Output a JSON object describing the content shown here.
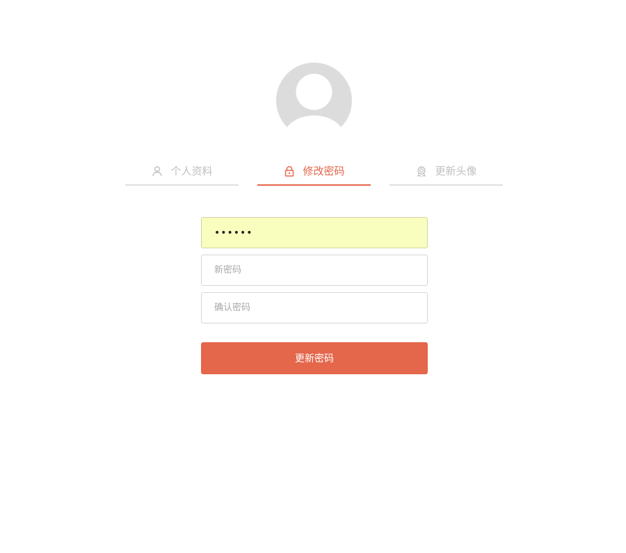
{
  "avatar": {
    "icon": "user-silhouette-icon"
  },
  "tabs": [
    {
      "label": "个人资料",
      "icon": "user-icon",
      "active": false
    },
    {
      "label": "修改密码",
      "icon": "lock-icon",
      "active": true
    },
    {
      "label": "更新头像",
      "icon": "badge-icon",
      "active": false
    }
  ],
  "form": {
    "old_password_value": "••••••",
    "new_password_placeholder": "新密码",
    "confirm_password_placeholder": "确认密码",
    "submit_label": "更新密码"
  },
  "colors": {
    "accent": "#e4664b",
    "inactive_text": "#c0c0c0",
    "autofill_bg": "#f9fdbd",
    "avatar_bg": "#dcdcdc"
  }
}
